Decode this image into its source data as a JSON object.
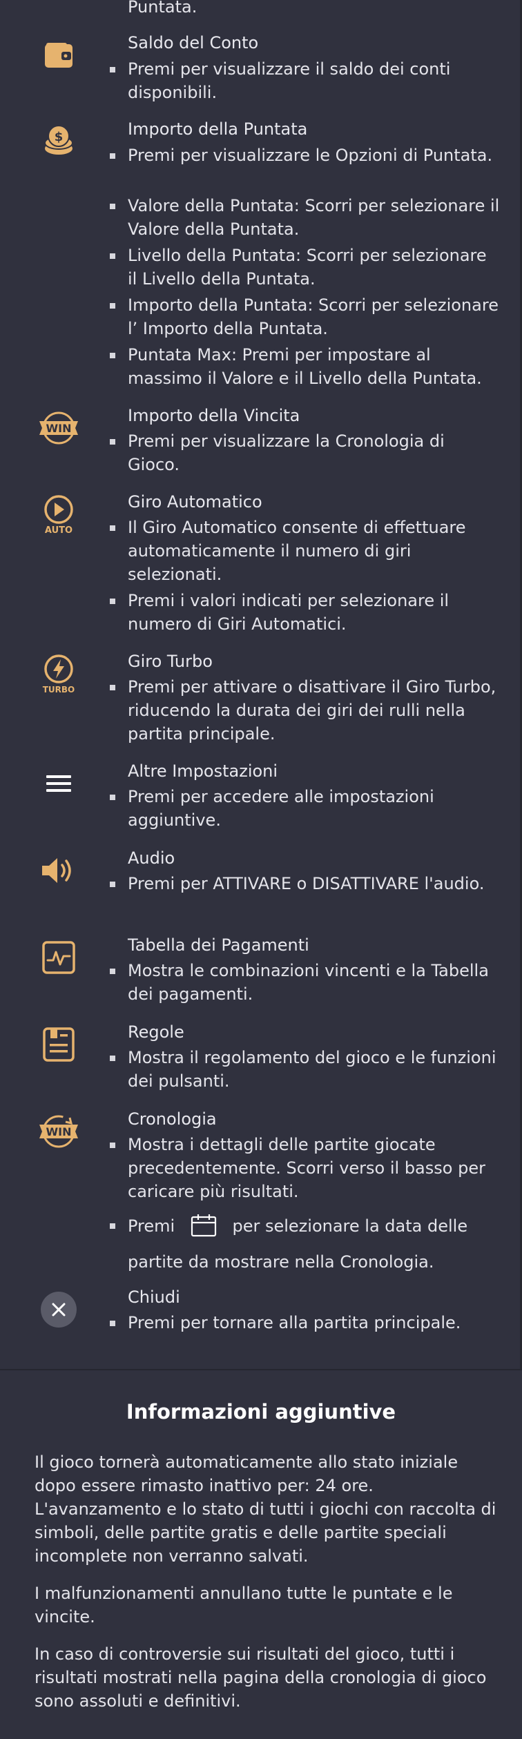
{
  "accent": "#e6b36e",
  "top_fragment": "Puntata.",
  "sections": {
    "saldo": {
      "icon": "wallet-icon",
      "title": "Saldo del Conto",
      "bullets": [
        "Premi per visualizzare il saldo dei conti disponibili."
      ]
    },
    "puntata": {
      "icon": "coins-icon",
      "title": "Importo della Puntata",
      "bullets": [
        "Premi per visualizzare le Opzioni di Puntata.",
        "Valore della Puntata: Scorri per selezionare il Valore della Puntata.",
        "Livello della Puntata: Scorri per selezionare il Livello della Puntata.",
        "Importo della Puntata: Scorri per selezionare l’  Importo della Puntata.",
        "Puntata Max: Premi per impostare al massimo il Valore e il Livello della Puntata."
      ]
    },
    "vincita": {
      "icon": "win-badge-icon",
      "icon_text": "WIN",
      "title": "Importo della Vincita",
      "bullets": [
        "Premi per visualizzare la Cronologia di Gioco."
      ]
    },
    "auto": {
      "icon": "auto-play-icon",
      "icon_text": "AUTO",
      "title": "Giro Automatico",
      "bullets": [
        "Il Giro Automatico consente di effettuare automaticamente il numero di giri selezionati.",
        "Premi i valori indicati per selezionare il numero di Giri Automatici."
      ]
    },
    "turbo": {
      "icon": "turbo-icon",
      "icon_text": "TURBO",
      "title": "Giro Turbo",
      "bullets": [
        "Premi per attivare o disattivare il Giro Turbo, riducendo la durata dei giri dei rulli nella partita principale."
      ]
    },
    "impostazioni": {
      "icon": "menu-icon",
      "title": "Altre Impostazioni",
      "bullets": [
        "Premi per accedere alle impostazioni aggiuntive."
      ]
    },
    "audio": {
      "icon": "speaker-icon",
      "title": "Audio",
      "bullets": [
        "Premi per ATTIVARE o DISATTIVARE l'audio."
      ]
    },
    "pagamenti": {
      "icon": "paytable-icon",
      "title": "Tabella dei Pagamenti",
      "bullets": [
        "Mostra le combinazioni vincenti e la Tabella dei pagamenti."
      ]
    },
    "regole": {
      "icon": "rules-icon",
      "title": "Regole",
      "bullets": [
        "Mostra il regolamento del gioco e le funzioni dei pulsanti."
      ]
    },
    "cronologia": {
      "icon": "history-win-icon",
      "icon_text": "WIN",
      "title": "Cronologia",
      "bullets": [
        "Mostra i dettagli delle partite giocate precedentemente. Scorri verso il basso per caricare più risultati."
      ],
      "calendar_before": "Premi",
      "calendar_after": "per selezionare la data delle",
      "calendar_line2": "partite da mostrare nella Cronologia."
    },
    "chiudi": {
      "icon": "close-icon",
      "title": "Chiudi",
      "bullets": [
        "Premi per tornare alla partita principale."
      ]
    }
  },
  "info": {
    "title": "Informazioni aggiuntive",
    "paragraphs": [
      "Il gioco tornerà automaticamente allo stato iniziale dopo essere rimasto inattivo per: 24 ore. L'avanzamento e lo stato di tutti i giochi con raccolta di simboli, delle partite gratis e delle partite speciali incomplete non verranno salvati.",
      "I malfunzionamenti annullano tutte le puntate e le vincite.",
      "In caso di controversie sui risultati del gioco, tutti i risultati mostrati nella pagina della cronologia di gioco sono assoluti e definitivi."
    ]
  }
}
